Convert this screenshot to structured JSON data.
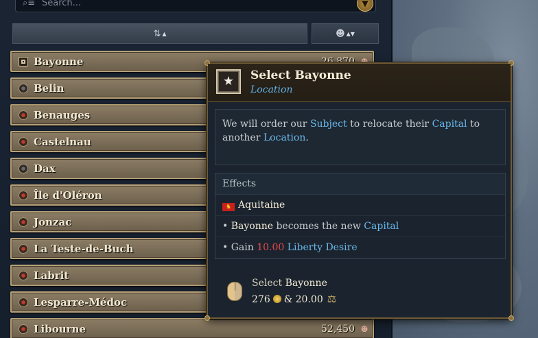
{
  "search": {
    "placeholder": "Search..."
  },
  "sort": {
    "primary_arrow": "▲",
    "secondary_arrow": "▲▼"
  },
  "locations": [
    {
      "name": "Bayonne",
      "value": "26,870",
      "bullet": "square"
    },
    {
      "name": "Belin",
      "value": "",
      "bullet": "grey"
    },
    {
      "name": "Benauges",
      "value": "",
      "bullet": "red"
    },
    {
      "name": "Castelnau",
      "value": "",
      "bullet": "red"
    },
    {
      "name": "Dax",
      "value": "",
      "bullet": "grey"
    },
    {
      "name": "Île d'Oléron",
      "value": "",
      "bullet": "red"
    },
    {
      "name": "Jonzac",
      "value": "",
      "bullet": "red"
    },
    {
      "name": "La Teste-de-Buch",
      "value": "",
      "bullet": "red"
    },
    {
      "name": "Labrit",
      "value": "",
      "bullet": "red"
    },
    {
      "name": "Lesparre-Médoc",
      "value": "",
      "bullet": "red"
    },
    {
      "name": "Libourne",
      "value": "52,450",
      "bullet": "red"
    }
  ],
  "tooltip": {
    "title_prefix": "Select ",
    "title_name": "Bayonne",
    "subtitle": "Location",
    "desc": {
      "p1": "We will order our ",
      "subject": "Subject",
      "p2": " to relocate their ",
      "capital": "Capital",
      "p3": " to another ",
      "location": "Location",
      "p4": "."
    },
    "effects_header": "Effects",
    "country": "Aquitaine",
    "effect1": {
      "bullet": "• ",
      "name": "Bayonne",
      "text": " becomes the new ",
      "capital": "Capital"
    },
    "effect2": {
      "bullet": "• ",
      "text": "Gain ",
      "amount": "10.00",
      "stat": "Liberty Desire"
    },
    "action": {
      "title_prefix": "Select ",
      "title_name": "Bayonne",
      "gold": "276",
      "joiner": "& 20.00"
    }
  },
  "colors": {
    "keyword": "#6ab8ec",
    "negative": "#e8484c",
    "frame_gold": "#6e5a38"
  }
}
